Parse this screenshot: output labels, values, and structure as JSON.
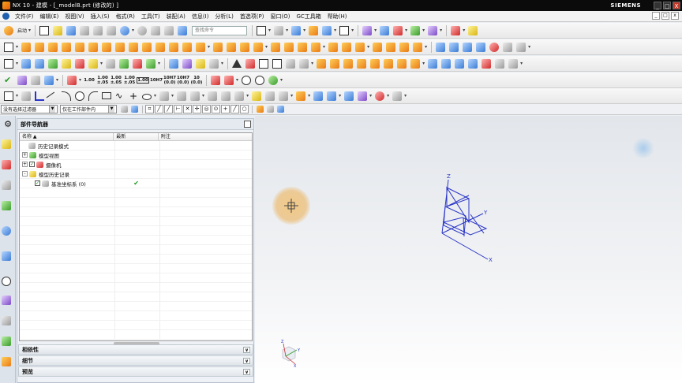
{
  "window": {
    "title": "NX 10 - 建模 - [_model8.prt  (修改的) ]",
    "brand": "SIEMENS",
    "controls": [
      "_",
      "□",
      "X"
    ]
  },
  "menubar": {
    "items": [
      "文件(F)",
      "编辑(E)",
      "视图(V)",
      "插入(S)",
      "格式(R)",
      "工具(T)",
      "装配(A)",
      "信息(I)",
      "分析(L)",
      "首选项(P)",
      "窗口(O)",
      "GC工具箱",
      "帮助(H)"
    ]
  },
  "toolbar1": {
    "start_label": "启动",
    "search_placeholder": "查找命令"
  },
  "toolbar3": {
    "dims": [
      {
        "top": "1.00",
        "bottom": ""
      },
      {
        "top": "1.00",
        "bottom": "±.05"
      },
      {
        "top": "1.00",
        "bottom": "±.05"
      },
      {
        "top": "1.00",
        "bottom": "±.05"
      },
      {
        "top": "1.00",
        "bottom": ""
      },
      {
        "top": "10H7",
        "bottom": ""
      },
      {
        "top": "10H7",
        "bottom": "(0.0)"
      },
      {
        "top": "10H7",
        "bottom": "(0.0)"
      },
      {
        "top": "10",
        "bottom": "(0.0)"
      }
    ]
  },
  "selection_bar": {
    "filter_value": "没有选择过滤器",
    "scope_value": "仅在工作部件内"
  },
  "part_navigator": {
    "title": "部件导航器",
    "columns": [
      "名称",
      "最新",
      "附注"
    ],
    "rows": [
      {
        "label": "历史记录模式",
        "indent": 1,
        "toggle": "",
        "checked": false,
        "latest": false
      },
      {
        "label": "模型视图",
        "indent": 0,
        "toggle": "+",
        "checked": false,
        "latest": false
      },
      {
        "label": "摄像机",
        "indent": 0,
        "toggle": "+",
        "checked": true,
        "latest": false
      },
      {
        "label": "模型历史记录",
        "indent": 0,
        "toggle": "-",
        "checked": false,
        "latest": false
      },
      {
        "label": "基准坐标系 (0)",
        "indent": 2,
        "toggle": "",
        "checked": true,
        "latest": true
      }
    ],
    "latest_mark": "✔",
    "sections": [
      "相依性",
      "细节",
      "预览"
    ]
  },
  "graphics": {
    "axes": {
      "x": "X",
      "y": "Y",
      "z": "Z"
    },
    "triad_axes": {
      "x": "X",
      "y": "Y",
      "z": "Z"
    }
  },
  "colors": {
    "titlebar": "#0b0b0b",
    "csys": "#2a35c8",
    "check": "#1a9a1a"
  }
}
